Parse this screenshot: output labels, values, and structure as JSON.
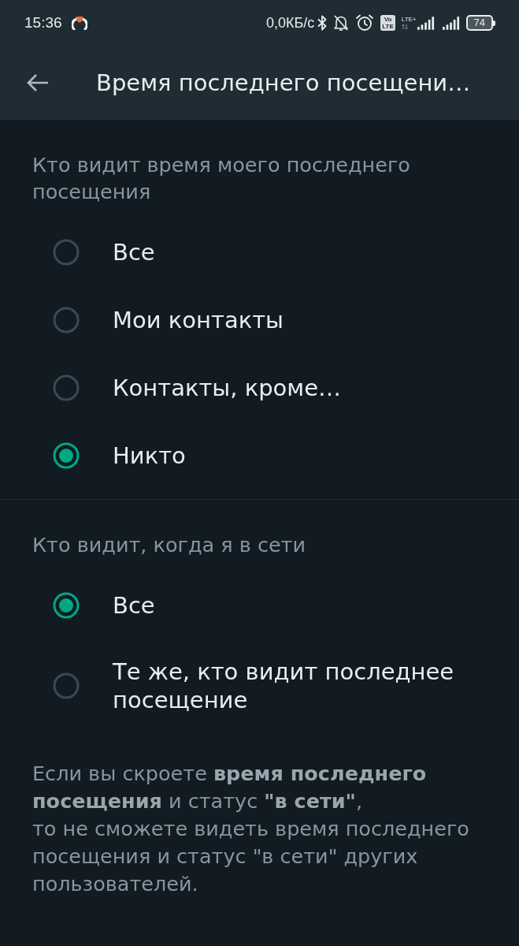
{
  "status_bar": {
    "time": "15:36",
    "network_speed": "0,0КБ/с",
    "volte_badge": {
      "top": "Vo",
      "bottom": "LTE"
    },
    "network_type": "LTE+",
    "battery": "74"
  },
  "app_bar": {
    "title": "Время последнего посещени…"
  },
  "sections": [
    {
      "header": "Кто видит время моего последнего посещения",
      "options": [
        {
          "label": "Все",
          "selected": false
        },
        {
          "label": "Мои контакты",
          "selected": false
        },
        {
          "label": "Контакты, кроме…",
          "selected": false
        },
        {
          "label": "Никто",
          "selected": true
        }
      ]
    },
    {
      "header": "Кто видит, когда я в сети",
      "options": [
        {
          "label": "Все",
          "selected": true
        },
        {
          "label": "Те же, кто видит последнее посещение",
          "selected": false
        }
      ]
    }
  ],
  "footnote": "Если вы скроете **время последнего посещения** и статус **\"в сети\"**,\nто не сможете видеть время последнего посещения и статус \"в сети\" других пользователей."
}
